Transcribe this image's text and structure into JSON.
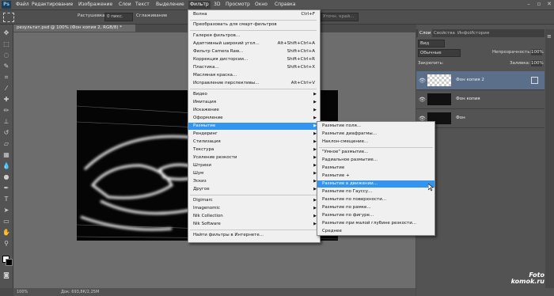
{
  "menubar": {
    "logo": "Ps",
    "items": [
      "Файл",
      "Редактирование",
      "Изображение",
      "Слои",
      "Текст",
      "Выделение",
      "Фильтр",
      "3D",
      "Просмотр",
      "Окно",
      "Справка"
    ],
    "active_index": 6,
    "window_controls": [
      "–",
      "▫",
      "✕"
    ]
  },
  "options": {
    "feather_label": "Растушевка:",
    "feather_value": "0 пикс.",
    "antialias": "Сглаживание",
    "refine_edge": "Уточн. край..."
  },
  "document": {
    "tab": "результат.psd @ 100% (Фон копия 2, RGB/8) *",
    "status": "Док: 693,8К/2,25М",
    "zoom": "100%"
  },
  "layers_panel": {
    "tabs": [
      "Слои",
      "Свойства",
      "Инфо",
      "История"
    ],
    "kind": "Вид",
    "blend_mode": "Обычные",
    "opacity_label": "Непрозрачность:",
    "opacity_value": "100%",
    "lock_label": "Закрепить:",
    "fill_label": "Заливка:",
    "fill_value": "100%",
    "layers": [
      {
        "name": "Фон копия 2",
        "selected": true
      },
      {
        "name": "Фон копия",
        "selected": false
      },
      {
        "name": "Фон",
        "selected": false
      }
    ]
  },
  "filter_menu": {
    "items": [
      {
        "label": "Волна",
        "shortcut": "Ctrl+F"
      },
      {
        "label": "Преобразовать для смарт-фильтров",
        "shortcut": ""
      },
      {
        "label": "Галерея фильтров...",
        "shortcut": ""
      },
      {
        "label": "Адаптивный широкий угол...",
        "shortcut": "Alt+Shift+Ctrl+A"
      },
      {
        "label": "Фильтр Camera Raw...",
        "shortcut": "Shift+Ctrl+A"
      },
      {
        "label": "Коррекция дисторсии...",
        "shortcut": "Shift+Ctrl+R"
      },
      {
        "label": "Пластика...",
        "shortcut": "Shift+Ctrl+X"
      },
      {
        "label": "Масляная краска...",
        "shortcut": ""
      },
      {
        "label": "Исправление перспективы...",
        "shortcut": "Alt+Ctrl+V"
      },
      {
        "label": "Видео",
        "shortcut": ""
      },
      {
        "label": "Имитация",
        "shortcut": ""
      },
      {
        "label": "Искажение",
        "shortcut": ""
      },
      {
        "label": "Оформление",
        "shortcut": ""
      },
      {
        "label": "Размытие",
        "shortcut": ""
      },
      {
        "label": "Рендеринг",
        "shortcut": ""
      },
      {
        "label": "Стилизация",
        "shortcut": ""
      },
      {
        "label": "Текстура",
        "shortcut": ""
      },
      {
        "label": "Усиление резкости",
        "shortcut": ""
      },
      {
        "label": "Штрихи",
        "shortcut": ""
      },
      {
        "label": "Шум",
        "shortcut": ""
      },
      {
        "label": "Эскиз",
        "shortcut": ""
      },
      {
        "label": "Другое",
        "shortcut": ""
      },
      {
        "label": "Digimarc",
        "shortcut": ""
      },
      {
        "label": "Imagenomic",
        "shortcut": ""
      },
      {
        "label": "Nik Collection",
        "shortcut": ""
      },
      {
        "label": "Nik Software",
        "shortcut": ""
      },
      {
        "label": "Найти фильтры в Интернете...",
        "shortcut": ""
      }
    ]
  },
  "blur_submenu": {
    "items": [
      "Размытие поля...",
      "Размытие диафрагмы...",
      "Наклон-смещение...",
      "\"Умное\" размытие...",
      "Радиальное размытие...",
      "Размытие",
      "Размытие +",
      "Размытие в движении...",
      "Размытие по Гауссу...",
      "Размытие по поверхности...",
      "Размытие по рамке...",
      "Размытие по фигуре...",
      "Размытие при малой глубине резкости...",
      "Среднее"
    ]
  },
  "watermark": {
    "line1": "Foto",
    "line2": "komok.ru"
  },
  "colors": {
    "highlight": "#3296f0",
    "selected_layer": "#5b6f8a"
  }
}
